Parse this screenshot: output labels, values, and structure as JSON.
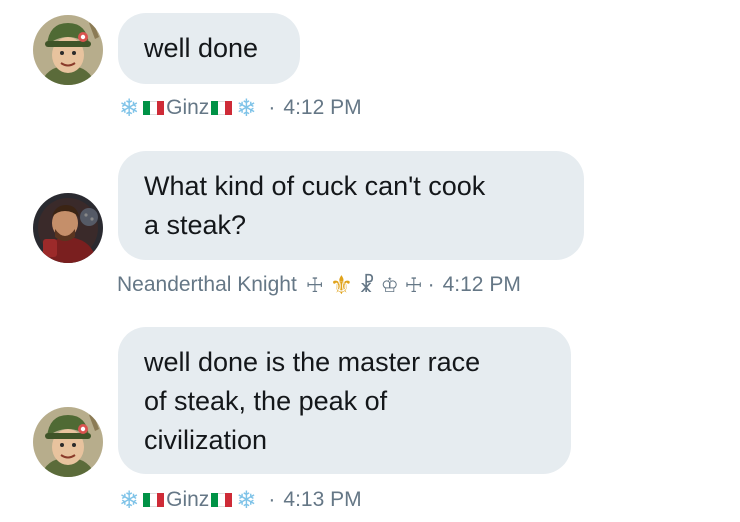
{
  "messages": [
    {
      "lines": [
        "well done"
      ],
      "sender": {
        "snow_left": "❄️",
        "flag_left": "🇮🇹",
        "name": "Ginz",
        "flag_right": "🇮🇹",
        "snow_right": "❄️"
      },
      "separator": "·",
      "time": "4:12 PM"
    },
    {
      "lines": [
        "What kind of cuck can't cook",
        "a steak?"
      ],
      "sender": {
        "name": "Neanderthal Knight",
        "glyphs": [
          "☩",
          "⚜",
          "☧",
          "♔",
          "☩"
        ]
      },
      "separator": "·",
      "time": "4:12 PM"
    },
    {
      "lines": [
        "well done is the master race",
        "of steak, the peak of",
        "civilization"
      ],
      "sender": {
        "snow_left": "❄️",
        "flag_left": "🇮🇹",
        "name": "Ginz",
        "flag_right": "🇮🇹",
        "snow_right": "❄️"
      },
      "separator": "·",
      "time": "4:13 PM"
    }
  ],
  "colors": {
    "bubble": "#e6ecf0",
    "text": "#14171a",
    "meta": "#657786",
    "flag_green": "#009246",
    "flag_white": "#ffffff",
    "flag_red": "#ce2b37"
  }
}
